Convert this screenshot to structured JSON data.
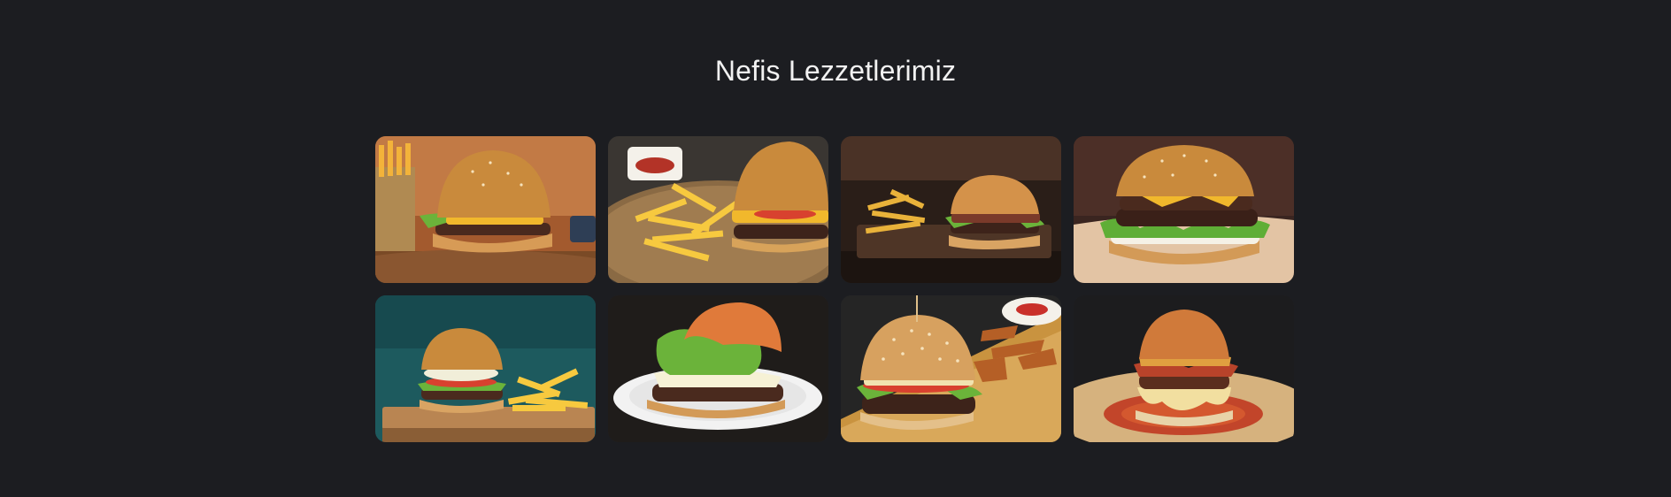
{
  "section": {
    "title": "Nefis Lezzetlerimiz"
  },
  "gallery": {
    "items": [
      {
        "icon": "burger-with-fries-basket-photo"
      },
      {
        "icon": "burger-and-fries-plate-photo"
      },
      {
        "icon": "burger-dark-board-photo"
      },
      {
        "icon": "double-cheeseburger-photo"
      },
      {
        "icon": "burger-teal-background-photo"
      },
      {
        "icon": "burger-white-plate-photo"
      },
      {
        "icon": "sesame-burger-wedges-photo"
      },
      {
        "icon": "bacon-burger-sauce-photo"
      }
    ]
  },
  "colors": {
    "page_background": "#1c1d21",
    "title_text": "#f2f2f2",
    "bun": "#c98a3c",
    "patty": "#4a2a1e",
    "lettuce": "#6bb33a",
    "cheese": "#f1b82c"
  }
}
